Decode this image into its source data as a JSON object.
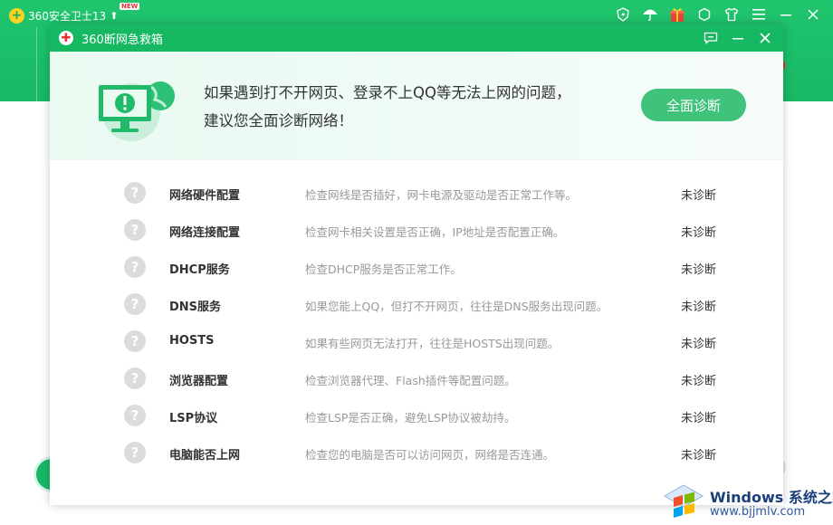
{
  "background_app": {
    "title": "360安全卫士13",
    "badge": "NEW"
  },
  "dialog": {
    "title": "360断网急救箱",
    "banner": {
      "line1": "如果遇到打不开网页、登录不上QQ等无法上网的问题，",
      "line2": "建议您全面诊断网络！",
      "button_label": "全面诊断"
    },
    "items": [
      {
        "name": "网络硬件配置",
        "desc": "检查网线是否插好，网卡电源及驱动是否正常工作等。",
        "status": "未诊断"
      },
      {
        "name": "网络连接配置",
        "desc": "检查网卡相关设置是否正确，IP地址是否配置正确。",
        "status": "未诊断"
      },
      {
        "name": "DHCP服务",
        "desc": "检查DHCP服务是否正常工作。",
        "status": "未诊断"
      },
      {
        "name": "DNS服务",
        "desc": "如果您能上QQ，但打不开网页，往往是DNS服务出现问题。",
        "status": "未诊断"
      },
      {
        "name": "HOSTS",
        "desc": "如果有些网页无法打开，往往是HOSTS出现问题。",
        "status": "未诊断"
      },
      {
        "name": "浏览器配置",
        "desc": "检查浏览器代理、Flash插件等配置问题。",
        "status": "未诊断"
      },
      {
        "name": "LSP协议",
        "desc": "检查LSP是否正确，避免LSP协议被劫持。",
        "status": "未诊断"
      },
      {
        "name": "电脑能否上网",
        "desc": "检查您的电脑是否可以访问网页，网络是否连通。",
        "status": "未诊断"
      }
    ]
  },
  "watermark": {
    "line1": "Windows 系统之家",
    "line2": "www.bjjmlv.com"
  },
  "colors": {
    "brand_green": "#16b862",
    "button_green": "#3fc27a",
    "question_gray": "#dcdcdc"
  }
}
